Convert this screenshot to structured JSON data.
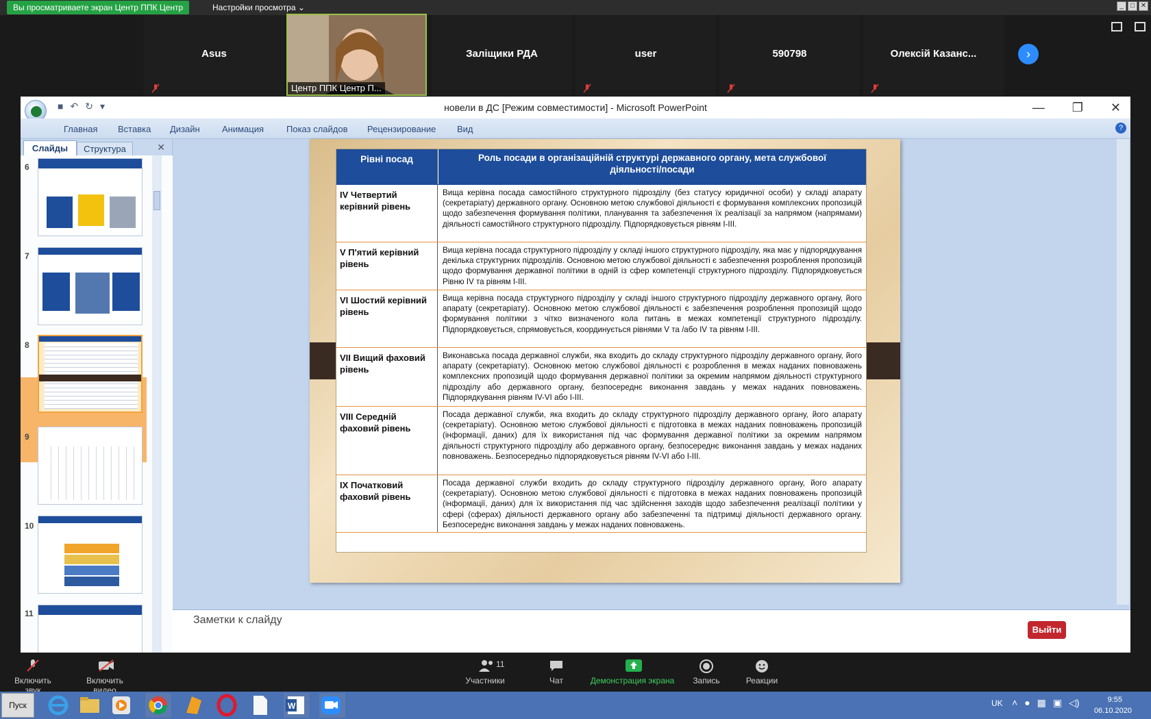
{
  "share_bar": {
    "status": "Вы просматриваете экран Центр ППК Центр",
    "view_settings": "Настройки просмотра ⌄"
  },
  "participants": [
    {
      "name": "Asus"
    },
    {
      "name": "Центр ППК Центр П..."
    },
    {
      "name": "Заліщики РДА"
    },
    {
      "name": "user"
    },
    {
      "name": "590798"
    },
    {
      "name": "Олексій Казанс..."
    }
  ],
  "ppt": {
    "window_title": "новели в ДС [Режим совместимости] - Microsoft PowerPoint",
    "ribbon_tabs": [
      "Главная",
      "Вставка",
      "Дизайн",
      "Анимация",
      "Показ слайдов",
      "Рецензирование",
      "Вид"
    ],
    "pane_tabs": {
      "slides": "Слайды",
      "outline": "Структура"
    },
    "thumbnails": [
      "6",
      "7",
      "8",
      "9",
      "10",
      "11"
    ],
    "selected_thumbnail": "8",
    "notes_label": "Заметки к слайду"
  },
  "table": {
    "headers": [
      "Рівні посад",
      "Роль посади в організаційній структурі державного органу, мета службової діяльності/посади"
    ],
    "rows": [
      {
        "level": "IV Четвертий керівний рівень",
        "desc": "Вища керівна посада самостійного структурного підрозділу (без статусу юридичної особи) у складі апарату (секретаріату) державного органу. Основною метою службової діяльності є формування комплексних пропозицій щодо забезпечення формування політики, планування та забезпечення їх реалізації за напрямом (напрямами) діяльності самостійного структурного підрозділу. Підпорядковується рівням I-III."
      },
      {
        "level": "V П'ятий керівний рівень",
        "desc": "Вища керівна посада структурного підрозділу у складі іншого структурного підрозділу, яка має у підпорядкування декілька структурних підрозділів. Основною метою службової діяльності є забезпечення розроблення пропозицій щодо формування державної політики в одній із сфер компетенції структурного підрозділу. Підпорядковується Рівню IV та рівням I-III."
      },
      {
        "level": "VI Шостий керівний рівень",
        "desc": "Вища керівна посада структурного підрозділу у складі іншого структурного підрозділу державного органу, його апарату (секретаріату). Основною метою службової діяльності є забезпечення розроблення пропозицій щодо формування політики з чітко визначеного кола питань в межах компетенції структурного підрозділу. Підпорядковується, спрямовується, координується рівнями V та /або IV та рівням I-III."
      },
      {
        "level": "VII Вищий фаховий рівень",
        "desc": "Виконавська посада державної служби, яка входить до складу структурного підрозділу державного органу, його апарату (секретаріату). Основною метою службової діяльності є розроблення в межах наданих повноважень комплексних пропозицій щодо формування державної політики за окремим напрямом діяльності структурного підрозділу або державного органу, безпосереднє виконання завдань у межах наданих повноважень. Підпорядкування рівням IV-VI або I-III."
      },
      {
        "level": "VIII Середній фаховий рівень",
        "desc": "Посада державної служби, яка входить до складу структурного підрозділу державного органу, його апарату (секретаріату). Основною метою службової діяльності є підготовка в межах наданих повноважень пропозицій (інформації, даних) для їх використання під час формування державної політики за окремим напрямом діяльності структурного підрозділу або державного органу, безпосереднє виконання завдань у межах наданих повноважень. Безпосередньо підпорядковується рівням IV-VI або I-III."
      },
      {
        "level": "IX Початковий фаховий рівень",
        "desc": "Посада державної служби входить до складу структурного підрозділу державного органу, його апарату (секретаріату). Основною метою службової діяльності є підготовка в межах наданих повноважень пропозицій (інформації, даних) для їх використання під час здійснення заходів щодо забезпечення реалізації політики у сфері (сферах) діяльності державного органу або забезпеченні та підтримці діяльності державного органу. Безпосереднє виконання завдань у межах наданих повноважень."
      }
    ]
  },
  "zoom_toolbar": {
    "mute": "Включить звук",
    "video": "Включить видео",
    "participants": "Участники",
    "participants_count": "11",
    "chat": "Чат",
    "share": "Демонстрация экрана",
    "record": "Запись",
    "reactions": "Реакции",
    "leave": "Выйти"
  },
  "taskbar": {
    "start": "Пуск",
    "lang": "UK",
    "time": "9:55",
    "date": "06.10.2020"
  },
  "colors": {
    "share_green": "#25a244",
    "zoom_blue": "#2d8cff",
    "table_header": "#1d4d9b",
    "leave_red": "#c1272d"
  }
}
